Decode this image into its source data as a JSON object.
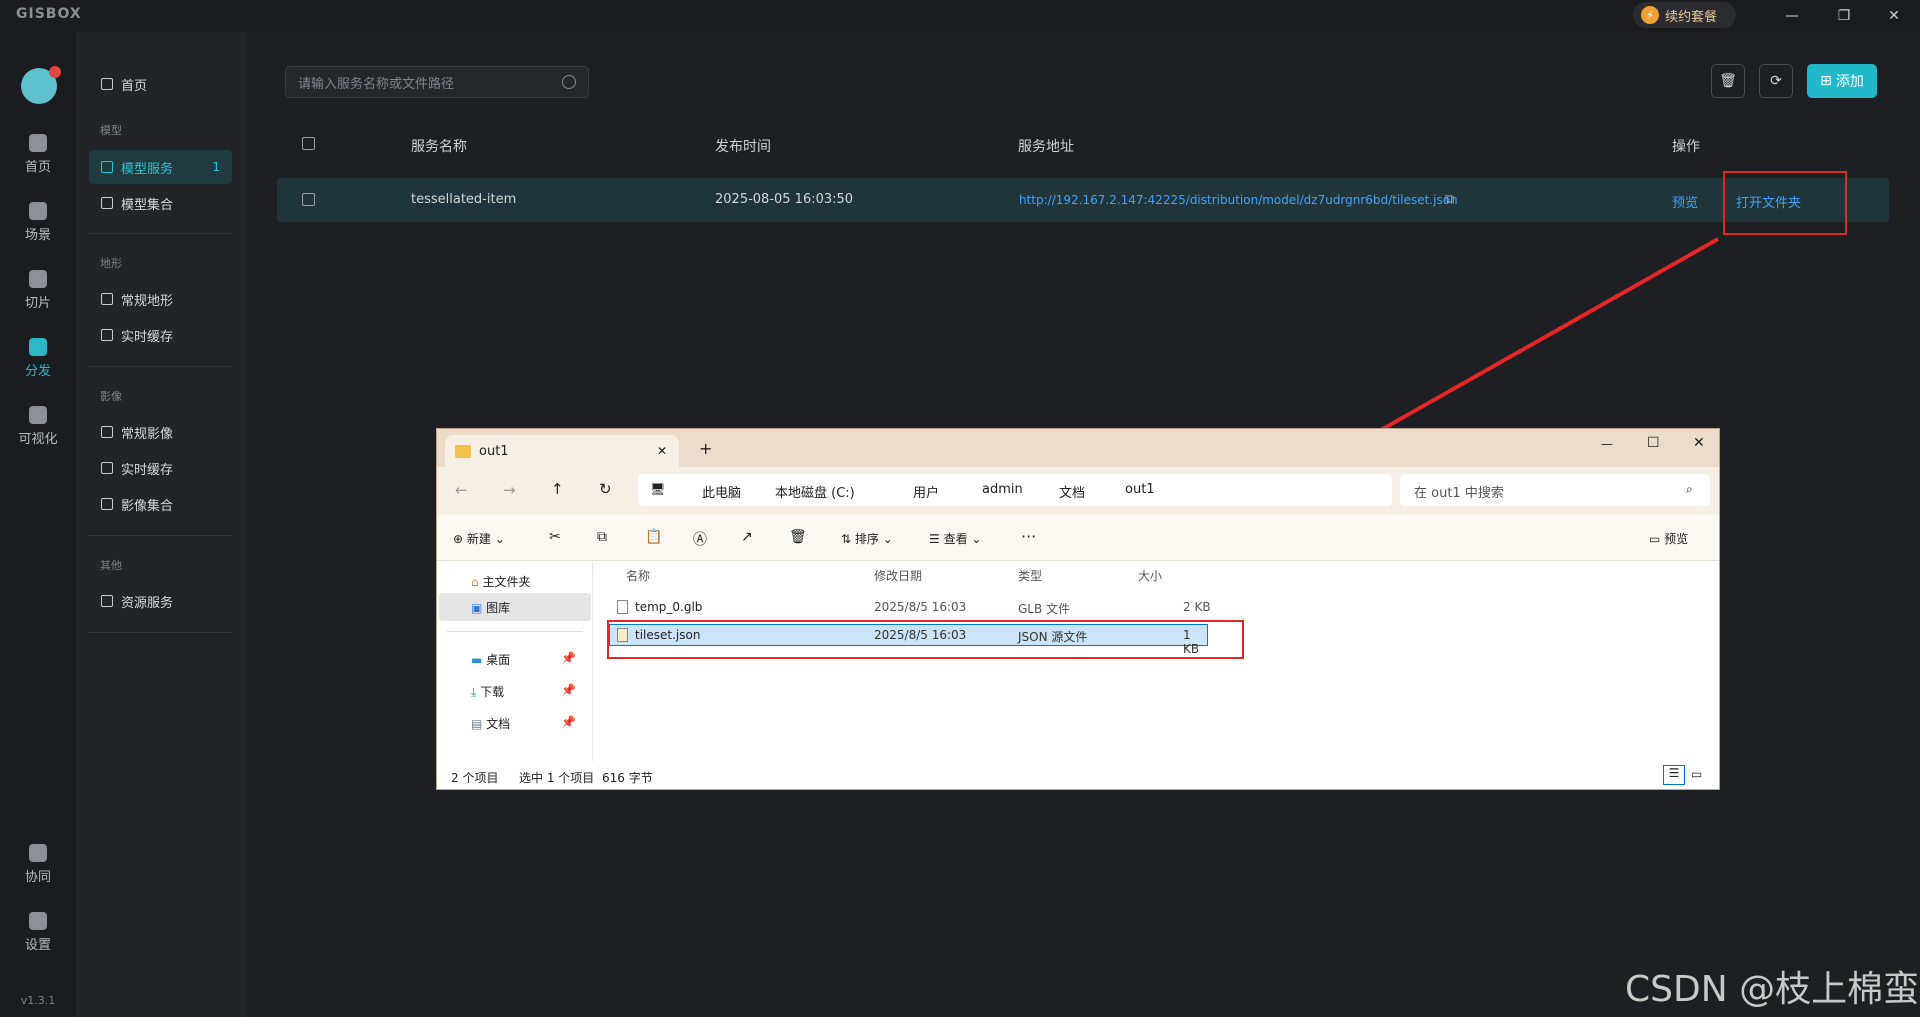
{
  "app": {
    "logo": "GISBOX",
    "renew_label": "续约套餐",
    "version": "v1.3.1"
  },
  "window_controls": {
    "minimize": "—",
    "restore": "❐",
    "close": "✕"
  },
  "rail": [
    {
      "label": "首页"
    },
    {
      "label": "场景"
    },
    {
      "label": "切片"
    },
    {
      "label": "分发"
    },
    {
      "label": "可视化"
    },
    {
      "label": "协同"
    },
    {
      "label": "设置"
    }
  ],
  "nav": {
    "home": "首页",
    "groups": [
      {
        "title": "模型",
        "items": [
          {
            "label": "模型服务",
            "badge": "1"
          },
          {
            "label": "模型集合"
          }
        ]
      },
      {
        "title": "地形",
        "items": [
          {
            "label": "常规地形"
          },
          {
            "label": "实时缓存"
          }
        ]
      },
      {
        "title": "影像",
        "items": [
          {
            "label": "常规影像"
          },
          {
            "label": "实时缓存"
          },
          {
            "label": "影像集合"
          }
        ]
      },
      {
        "title": "其他",
        "items": [
          {
            "label": "资源服务"
          }
        ]
      }
    ]
  },
  "search": {
    "placeholder": "请输入服务名称或文件路径"
  },
  "toolbar": {
    "add_label": "添加",
    "delete_icon": "🗑",
    "refresh_icon": "⟳"
  },
  "table": {
    "headers": {
      "name": "服务名称",
      "time": "发布时间",
      "url": "服务地址",
      "ops": "操作"
    },
    "row": {
      "name": "tessellated-item",
      "time": "2025-08-05 16:03:50",
      "url": "http://192.167.2.147:42225/distribution/model/dz7udrgnr6bd/tileset.json",
      "preview": "预览",
      "open_folder": "打开文件夹"
    }
  },
  "explorer": {
    "tab_title": "out1",
    "new_tab": "+",
    "controls": {
      "min": "—",
      "max": "☐",
      "close": "✕"
    },
    "breadcrumbs": [
      "此电脑",
      "本地磁盘 (C:)",
      "用户",
      "admin",
      "文档",
      "out1"
    ],
    "search_placeholder": "在 out1 中搜索",
    "tools": {
      "new": "新建",
      "sort": "排序",
      "view": "查看",
      "more": "···",
      "preview": "预览"
    },
    "sidebar": {
      "home": "主文件夹",
      "gallery": "图库",
      "desktop": "桌面",
      "downloads": "下载",
      "documents": "文档"
    },
    "columns": {
      "name": "名称",
      "modified": "修改日期",
      "type": "类型",
      "size": "大小"
    },
    "files": [
      {
        "name": "temp_0.glb",
        "modified": "2025/8/5 16:03",
        "type": "GLB 文件",
        "size": "2 KB"
      },
      {
        "name": "tileset.json",
        "modified": "2025/8/5 16:03",
        "type": "JSON 源文件",
        "size": "1 KB"
      }
    ],
    "status": {
      "count": "2 个项目",
      "selected": "选中 1 个项目",
      "bytes": "616 字节"
    }
  },
  "watermark": "CSDN @枝上棉蛮",
  "colors": {
    "accent": "#22b7c9",
    "link": "#3fa3ff",
    "annotation": "#e2262a"
  }
}
